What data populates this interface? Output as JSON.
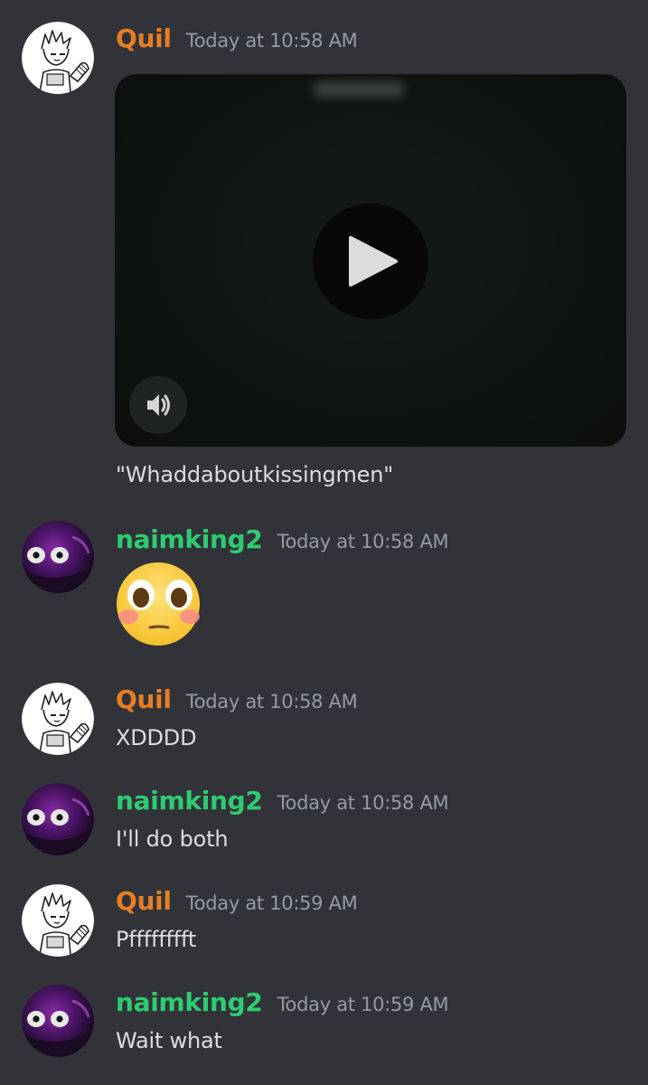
{
  "colors": {
    "background": "#313338",
    "quil_name": "#e67e22",
    "naimking_name": "#2ecc71",
    "timestamp": "#949ba4",
    "message_text": "#dbdee1"
  },
  "messages": [
    {
      "author": "Quil",
      "timestamp": "Today at 10:58 AM",
      "attachment": "video",
      "caption": "\"Whaddaboutkissingmen\"",
      "avatar": "quil-avatar"
    },
    {
      "author": "naimking2",
      "timestamp": "Today at 10:58 AM",
      "emoji": "flushed-emoji",
      "avatar": "naimking-avatar"
    },
    {
      "author": "Quil",
      "timestamp": "Today at 10:58 AM",
      "text": "XDDDD",
      "avatar": "quil-avatar"
    },
    {
      "author": "naimking2",
      "timestamp": "Today at 10:58 AM",
      "text": "I'll do both",
      "avatar": "naimking-avatar"
    },
    {
      "author": "Quil",
      "timestamp": "Today at 10:59 AM",
      "text": "Pfffffffft",
      "avatar": "quil-avatar"
    },
    {
      "author": "naimking2",
      "timestamp": "Today at 10:59 AM",
      "text": "Wait what",
      "avatar": "naimking-avatar"
    }
  ],
  "video": {
    "play_icon": "play-icon",
    "volume_icon": "volume-icon"
  }
}
